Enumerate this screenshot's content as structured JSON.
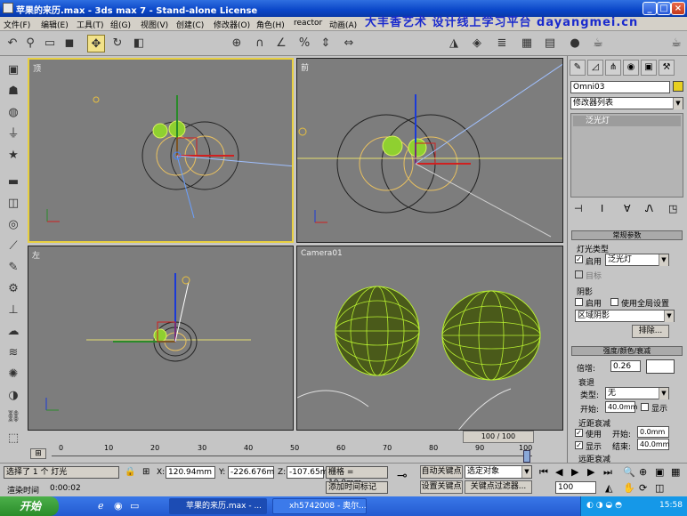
{
  "window": {
    "title": "苹果的来历.max - 3ds max 7 - Stand-alone License",
    "watermark": "大丰香艺术  设计线上学习平台  dayangmei.cn"
  },
  "menu": [
    "文件(F)",
    "编辑(E)",
    "工具(T)",
    "组(G)",
    "视图(V)",
    "创建(C)",
    "修改器(O)",
    "角色(H)",
    "reactor",
    "动画(A)",
    "图表编辑器(D)",
    "渲染(R)",
    "自定义(U)",
    "MAXScript(M)",
    "帮助(H)"
  ],
  "toolbar": {
    "ref_coord": "视图",
    "named_sel": "",
    "view_dropdown": "视图"
  },
  "viewports": {
    "top": "顶",
    "front": "前",
    "left": "左",
    "camera": "Camera01"
  },
  "command_panel": {
    "object_name": "Omni03",
    "modifier_list": "修改器列表",
    "stack_item": "泛光灯",
    "rollout_general": "常规参数",
    "light_type_group": "灯光类型",
    "enable_label": "启用",
    "light_type": "泛光灯",
    "target_label": "目标",
    "shadows_group": "阴影",
    "shadow_enable": "启用",
    "use_global": "使用全局设置",
    "shadow_type": "区域阴影",
    "exclude_btn": "排除...",
    "rollout_intensity": "强度/颜色/衰减",
    "multiplier_label": "倍增:",
    "multiplier": "0.26",
    "decay_group": "衰退",
    "type_label": "类型:",
    "decay_type": "无",
    "start_label": "开始:",
    "decay_start": "40.0mm",
    "show_label": "显示",
    "near_atten": "近距衰减",
    "use_label": "使用",
    "start2_label": "开始:",
    "near_start": "0.0mm",
    "show2_label": "显示",
    "end_label": "结束:",
    "near_end": "40.0mm",
    "far_atten": "远距衰减"
  },
  "timeline": {
    "frame_display": "100 / 100",
    "ticks": [
      "0",
      "10",
      "20",
      "30",
      "40",
      "50",
      "60",
      "70",
      "80",
      "90",
      "100"
    ]
  },
  "status": {
    "selection": "选择了 1 个 灯光",
    "x_label": "X:",
    "x": "120.94mm",
    "y_label": "Y:",
    "y": "-226.676m",
    "z_label": "Z:",
    "z": "-107.65mm",
    "grid": "栅格 = 10.0mm",
    "auto_key": "自动关键点",
    "selected_obj": "选定对象",
    "set_key": "设置关键点",
    "key_filters": "关键点过滤器...",
    "render_time_label": "渲染时间",
    "render_time": "0:00:02",
    "add_time_tag": "添加时间标记",
    "frame_field": "100"
  },
  "taskbar": {
    "start": "开始",
    "task1": "苹果的来历.max - ...",
    "task2": "xh5742008 - 奥尔...",
    "clock": "15:58"
  }
}
